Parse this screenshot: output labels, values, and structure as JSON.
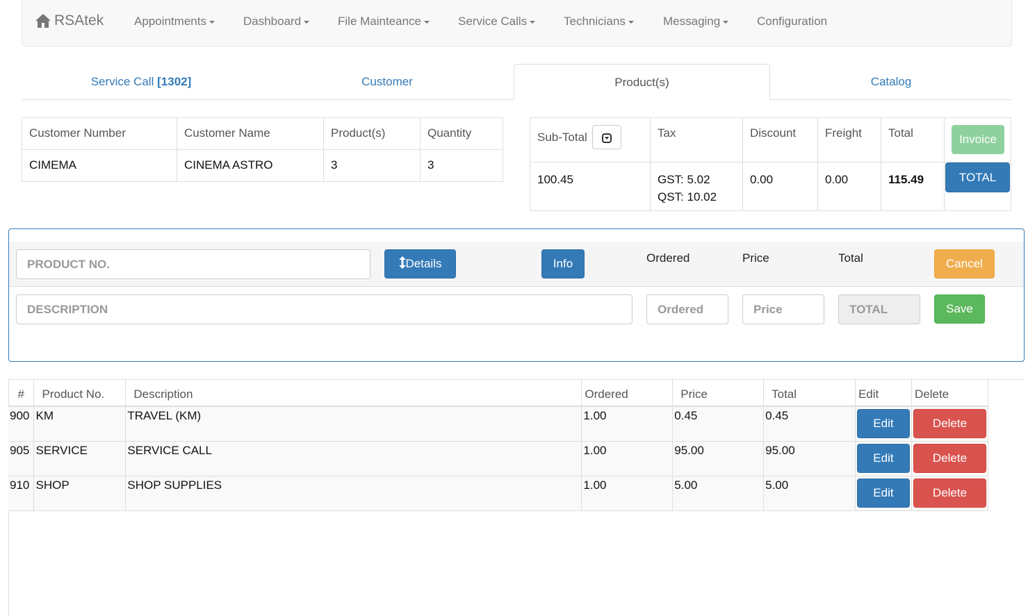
{
  "navbar": {
    "brand": "RSAtek",
    "items": [
      {
        "label": "Appointments",
        "dropdown": true
      },
      {
        "label": "Dashboard",
        "dropdown": true
      },
      {
        "label": "File Mainteance",
        "dropdown": true
      },
      {
        "label": "Service Calls",
        "dropdown": true
      },
      {
        "label": "Technicians",
        "dropdown": true
      },
      {
        "label": "Messaging",
        "dropdown": true
      },
      {
        "label": "Configuration",
        "dropdown": false
      }
    ]
  },
  "tabs": {
    "service_call_label": "Service Call",
    "service_call_number": "[1302]",
    "customer": "Customer",
    "products": "Product(s)",
    "catalog": "Catalog"
  },
  "customer_table": {
    "headers": [
      "Customer Number",
      "Customer Name",
      "Product(s)",
      "Quantity"
    ],
    "row": [
      "CIMEMA",
      "CINEMA ASTRO",
      "3",
      "3"
    ]
  },
  "totals_table": {
    "headers": {
      "subtotal": "Sub-Total",
      "tax": "Tax",
      "discount": "Discount",
      "freight": "Freight",
      "total": "Total"
    },
    "invoice_button": "Invoice",
    "total_button": "TOTAL",
    "subtotal": "100.45",
    "gst": "GST: 5.02",
    "qst": "QST: 10.02",
    "discount": "0.00",
    "freight": "0.00",
    "total": "115.49"
  },
  "edit_panel": {
    "product_no_placeholder": "PRODUCT NO.",
    "details_button": "Details",
    "info_button": "Info",
    "label_ordered": "Ordered",
    "label_price": "Price",
    "label_total": "Total",
    "cancel_button": "Cancel",
    "description_placeholder": "DESCRIPTION",
    "ordered_placeholder": "Ordered",
    "price_placeholder": "Price",
    "total_placeholder": "TOTAL",
    "save_button": "Save"
  },
  "product_table": {
    "headers": [
      "#",
      "Product No.",
      "Description",
      "Ordered",
      "Price",
      "Total",
      "Edit",
      "Delete"
    ],
    "rows": [
      {
        "num": "900",
        "product": "KM",
        "description": "TRAVEL (KM)",
        "ordered": "1.00",
        "price": "0.45",
        "total": "0.45"
      },
      {
        "num": "905",
        "product": "SERVICE",
        "description": "SERVICE CALL",
        "ordered": "1.00",
        "price": "95.00",
        "total": "95.00"
      },
      {
        "num": "910",
        "product": "SHOP",
        "description": "SHOP SUPPLIES",
        "ordered": "1.00",
        "price": "5.00",
        "total": "5.00"
      }
    ],
    "edit_label": "Edit",
    "delete_label": "Delete"
  },
  "colors": {
    "primary": "#337ab7",
    "success": "#5cb85c",
    "warning": "#f0ad4e",
    "danger": "#d9534f"
  }
}
